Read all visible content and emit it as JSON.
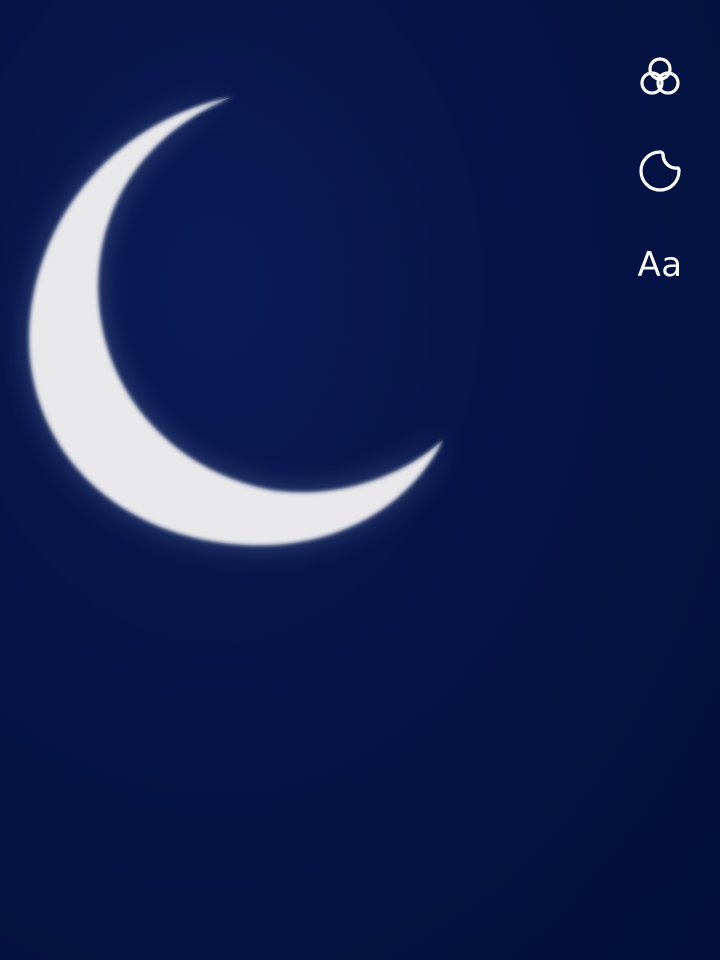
{
  "colors": {
    "background": "#03113f",
    "moon": "#e9e9ec",
    "icon": "#ffffff"
  },
  "toolbar": {
    "tools": [
      {
        "icon": "color-filters-icon"
      },
      {
        "icon": "sticker-icon"
      },
      {
        "icon": "text-tool-icon",
        "label": "Aa"
      }
    ]
  }
}
